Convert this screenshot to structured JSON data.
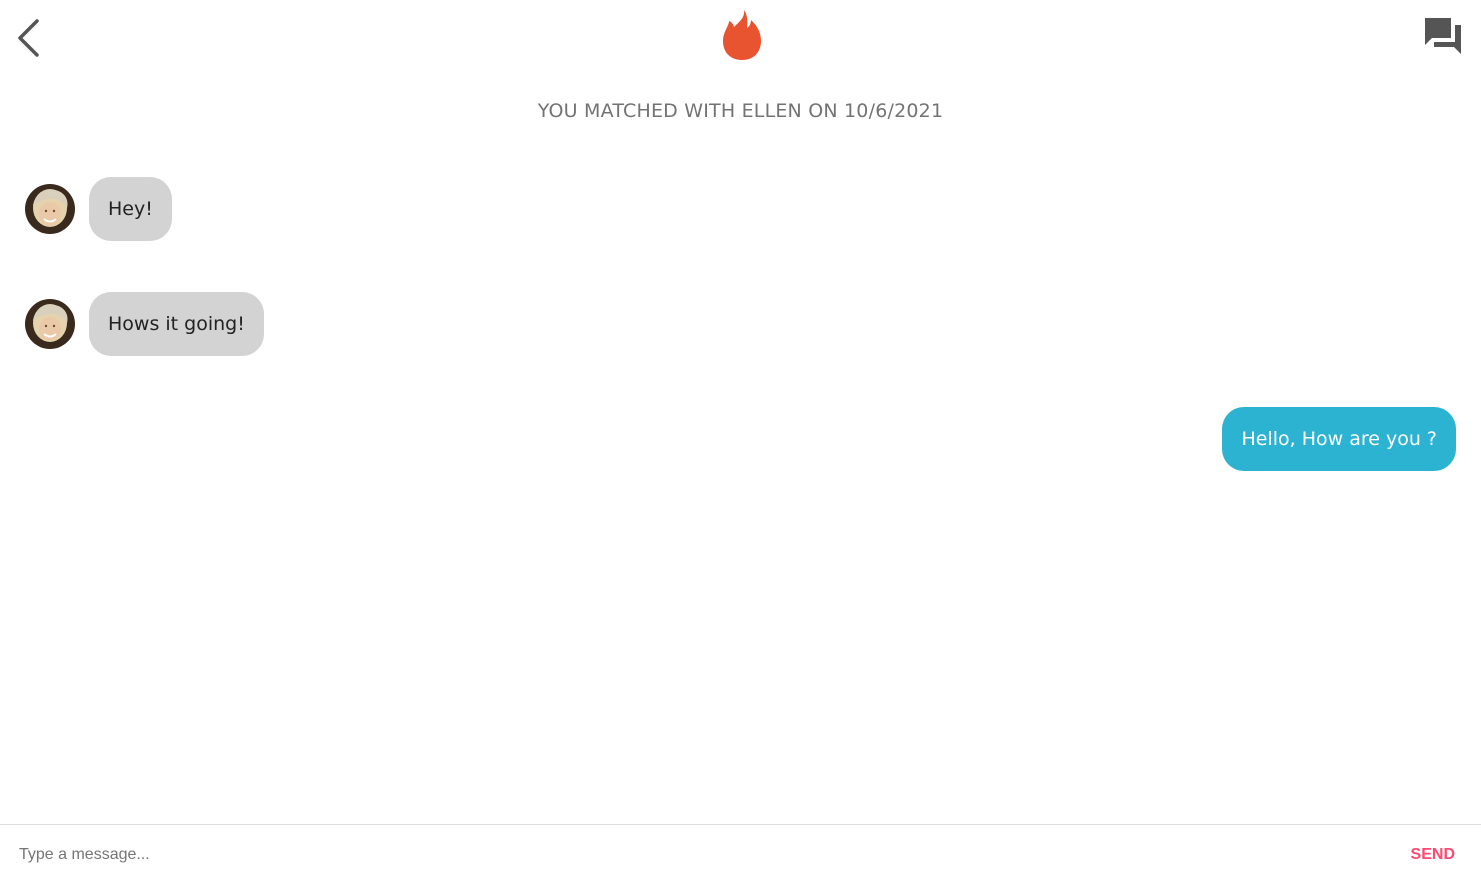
{
  "header": {
    "back_icon": "chevron-left-icon",
    "logo_icon": "flame-icon",
    "chat_icon": "chat-bubbles-icon"
  },
  "match_banner": "YOU MATCHED WITH ELLEN ON 10/6/2021",
  "messages": [
    {
      "from": "match",
      "text": "Hey!"
    },
    {
      "from": "match",
      "text": "Hows it going!"
    },
    {
      "from": "self",
      "text": "Hello, How are you ?"
    }
  ],
  "composer": {
    "placeholder": "Type a message...",
    "value": "",
    "send_label": "SEND"
  },
  "colors": {
    "brand_flame": "#e8542f",
    "incoming_bubble": "#d3d3d3",
    "outgoing_bubble": "#2bb3d1",
    "send_text": "#fd4a72",
    "banner_text": "#737373",
    "icon_gray": "#555555"
  }
}
